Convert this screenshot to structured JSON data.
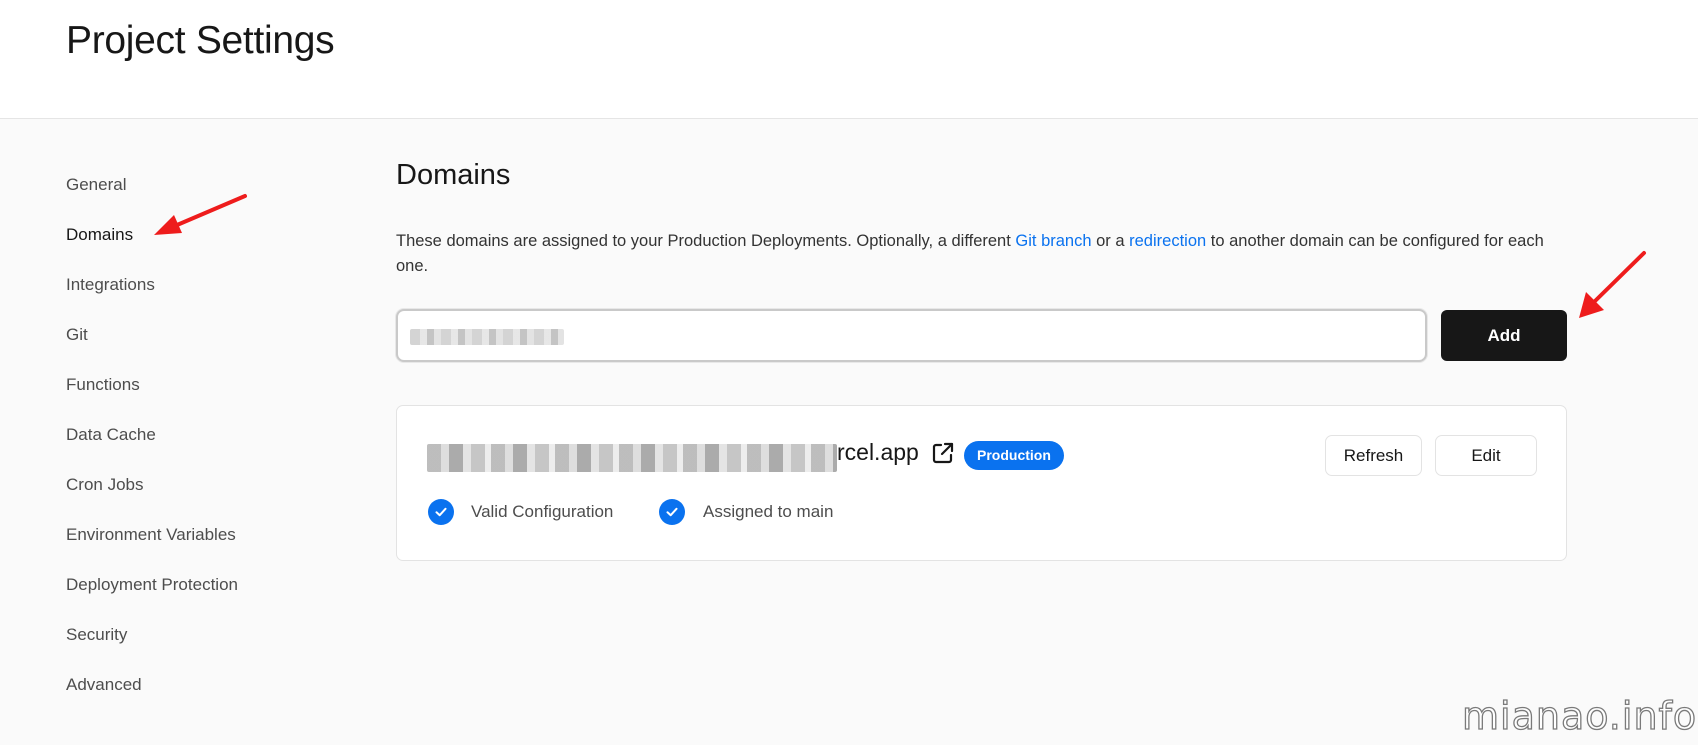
{
  "header": {
    "title": "Project Settings"
  },
  "sidebar": {
    "items": [
      {
        "label": "General"
      },
      {
        "label": "Domains"
      },
      {
        "label": "Integrations"
      },
      {
        "label": "Git"
      },
      {
        "label": "Functions"
      },
      {
        "label": "Data Cache"
      },
      {
        "label": "Cron Jobs"
      },
      {
        "label": "Environment Variables"
      },
      {
        "label": "Deployment Protection"
      },
      {
        "label": "Security"
      },
      {
        "label": "Advanced"
      }
    ],
    "active": "Domains"
  },
  "main": {
    "title": "Domains",
    "description": {
      "part1": "These domains are assigned to your Production Deployments. Optionally, a different ",
      "link1": "Git branch",
      "part2": " or a ",
      "link2": "redirection",
      "part3": " to another domain can be configured for each one."
    },
    "add_label": "Add",
    "domain": {
      "name_visible": "rcel.app",
      "badge": "Production",
      "refresh_label": "Refresh",
      "edit_label": "Edit",
      "status": [
        {
          "label": "Valid Configuration"
        },
        {
          "label": "Assigned to main"
        }
      ]
    }
  },
  "watermark": "mianao.info",
  "colors": {
    "accent": "#0a72ef",
    "primary_button": "#171717",
    "annotation_arrow": "#ee1c1c"
  },
  "icons": [
    "external-link-icon",
    "check-circle-icon",
    "annotation-arrow-icon"
  ]
}
